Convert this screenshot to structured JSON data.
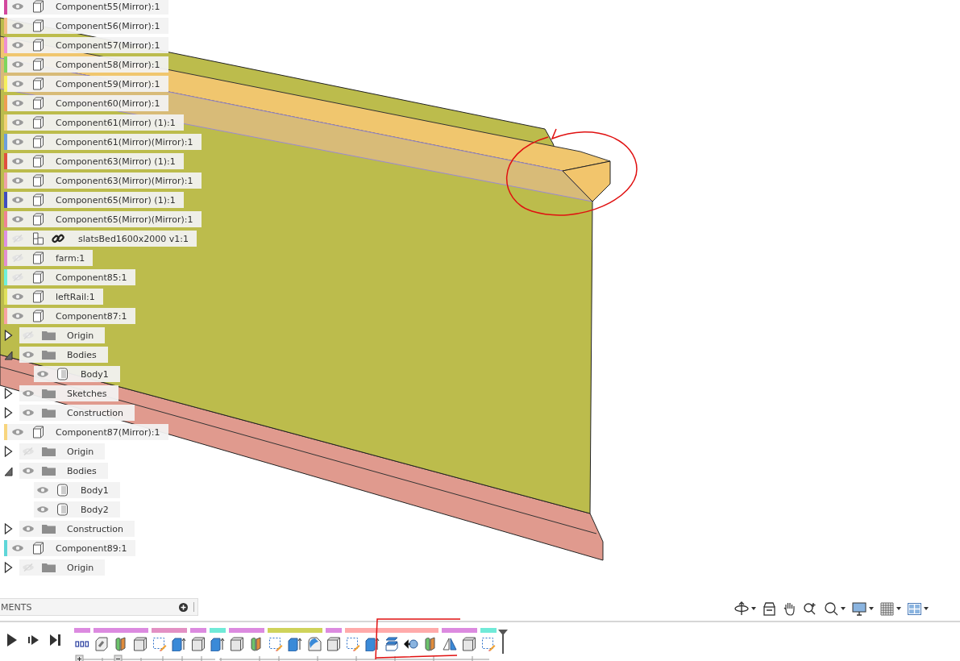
{
  "browser": {
    "items": [
      {
        "kind": "component",
        "label": "Component55(Mirror):1",
        "color": "#d2489e",
        "visible": true
      },
      {
        "kind": "component",
        "label": "Component56(Mirror):1",
        "color": "#f3bd84",
        "visible": true
      },
      {
        "kind": "component",
        "label": "Component57(Mirror):1",
        "color": "#ee8fd2",
        "visible": true
      },
      {
        "kind": "component",
        "label": "Component58(Mirror):1",
        "color": "#7fd65c",
        "visible": true
      },
      {
        "kind": "component",
        "label": "Component59(Mirror):1",
        "color": "#f5ef5e",
        "visible": true
      },
      {
        "kind": "component",
        "label": "Component60(Mirror):1",
        "color": "#ee9f52",
        "visible": true
      },
      {
        "kind": "component",
        "label": "Component61(Mirror) (1):1",
        "color": "#efd074",
        "visible": true
      },
      {
        "kind": "component",
        "label": "Component61(Mirror)(Mirror):1",
        "color": "#6c9fdc",
        "visible": true
      },
      {
        "kind": "component",
        "label": "Component63(Mirror) (1):1",
        "color": "#e0503e",
        "visible": true
      },
      {
        "kind": "component",
        "label": "Component63(Mirror)(Mirror):1",
        "color": "#eea2a6",
        "visible": true
      },
      {
        "kind": "component",
        "label": "Component65(Mirror) (1):1",
        "color": "#3f4dbf",
        "visible": true
      },
      {
        "kind": "component",
        "label": "Component65(Mirror)(Mirror):1",
        "color": "#ef8394",
        "visible": true
      },
      {
        "kind": "linked",
        "label": "slatsBed1600x2000 v1:1",
        "color": "#de90e2",
        "visible": false
      },
      {
        "kind": "component",
        "label": "farm:1",
        "color": "#e38fd0",
        "visible": false
      },
      {
        "kind": "component",
        "label": "Component85:1",
        "color": "#6ff0da",
        "visible": false
      },
      {
        "kind": "component",
        "label": "leftRail:1",
        "color": "#dfe05c",
        "visible": true
      },
      {
        "kind": "component",
        "label": "Component87:1",
        "color": "#f7a3a3",
        "visible": true,
        "children": [
          {
            "kind": "folder",
            "label": "Origin",
            "visible": false,
            "expanded": false
          },
          {
            "kind": "folder",
            "label": "Bodies",
            "visible": true,
            "expanded": true,
            "children": [
              {
                "kind": "body",
                "label": "Body1",
                "visible": true
              }
            ]
          },
          {
            "kind": "folder",
            "label": "Sketches",
            "visible": true,
            "expanded": false
          },
          {
            "kind": "folder",
            "label": "Construction",
            "visible": true,
            "expanded": false
          }
        ]
      },
      {
        "kind": "component",
        "label": "Component87(Mirror):1",
        "color": "#f8d57e",
        "visible": true,
        "children": [
          {
            "kind": "folder",
            "label": "Origin",
            "visible": false,
            "expanded": false
          },
          {
            "kind": "folder",
            "label": "Bodies",
            "visible": true,
            "expanded": true,
            "children": [
              {
                "kind": "body",
                "label": "Body1",
                "visible": true
              },
              {
                "kind": "body",
                "label": "Body2",
                "visible": true
              }
            ]
          },
          {
            "kind": "folder",
            "label": "Construction",
            "visible": true,
            "expanded": false
          }
        ]
      },
      {
        "kind": "component",
        "label": "Component89:1",
        "color": "#5fd6d8",
        "visible": true,
        "children": [
          {
            "kind": "folder",
            "label": "Origin",
            "visible": false,
            "expanded": false
          }
        ]
      }
    ]
  },
  "comments": {
    "title": "MENTS"
  },
  "timeline": {
    "groups": [
      {
        "color": "#dc8ae0",
        "features": [
          {
            "kind": "markers"
          }
        ]
      },
      {
        "color": "#dc8ae0",
        "features": [
          {
            "kind": "link"
          },
          {
            "kind": "split"
          },
          {
            "kind": "box"
          }
        ]
      },
      {
        "color": "#e390c4",
        "features": [
          {
            "kind": "sketch"
          },
          {
            "kind": "extrude"
          }
        ]
      },
      {
        "color": "#dc8ae0",
        "features": [
          {
            "kind": "box"
          }
        ]
      },
      {
        "color": "#70ead8",
        "features": [
          {
            "kind": "extrude"
          }
        ]
      },
      {
        "color": "#dc8ae0",
        "features": [
          {
            "kind": "box"
          },
          {
            "kind": "split"
          }
        ]
      },
      {
        "color": "#cfd35a",
        "features": [
          {
            "kind": "sketch"
          },
          {
            "kind": "extrude"
          },
          {
            "kind": "fillet"
          }
        ]
      },
      {
        "color": "#dc8ae0",
        "features": [
          {
            "kind": "box"
          }
        ]
      },
      {
        "color": "#ffaaaa",
        "features": [
          {
            "kind": "sketch"
          },
          {
            "kind": "extrude"
          },
          {
            "kind": "stack"
          },
          {
            "kind": "move"
          },
          {
            "kind": "split"
          }
        ]
      },
      {
        "color": "#dc8ae0",
        "features": [
          {
            "kind": "mirror"
          },
          {
            "kind": "box"
          }
        ]
      },
      {
        "color": "#70ead8",
        "features": [
          {
            "kind": "sketch"
          }
        ]
      }
    ]
  }
}
